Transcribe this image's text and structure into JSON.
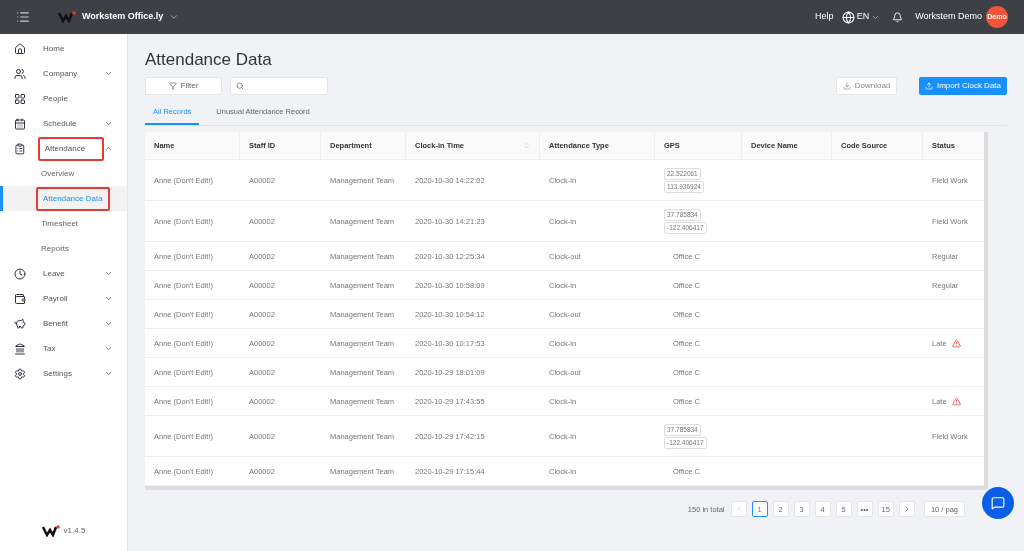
{
  "header": {
    "brand": "Workstem Office.ly",
    "help": "Help",
    "language": "EN",
    "user": "Workstem Demo",
    "avatar": "Demo"
  },
  "sidebar": {
    "items": [
      {
        "label": "Home",
        "expandable": false,
        "annotated": false
      },
      {
        "label": "Company",
        "expandable": true,
        "expanded": false,
        "annotated": false
      },
      {
        "label": "People",
        "expandable": false,
        "annotated": false
      },
      {
        "label": "Schedule",
        "expandable": true,
        "expanded": false,
        "annotated": false
      },
      {
        "label": "Attendance",
        "expandable": true,
        "expanded": true,
        "annotated": true,
        "children": [
          {
            "label": "Overview",
            "selected": false,
            "annotated": false
          },
          {
            "label": "Attendance Data",
            "selected": true,
            "annotated": true
          },
          {
            "label": "Timesheet",
            "selected": false,
            "annotated": false
          },
          {
            "label": "Reports",
            "selected": false,
            "annotated": false
          }
        ]
      },
      {
        "label": "Leave",
        "expandable": true,
        "expanded": false,
        "annotated": false
      },
      {
        "label": "Payroll",
        "expandable": true,
        "expanded": false,
        "annotated": false
      },
      {
        "label": "Benefit",
        "expandable": true,
        "expanded": false,
        "annotated": false
      },
      {
        "label": "Tax",
        "expandable": true,
        "expanded": false,
        "annotated": false
      },
      {
        "label": "Settings",
        "expandable": true,
        "expanded": false,
        "annotated": false
      }
    ],
    "version": "v1.4.5"
  },
  "page": {
    "title": "Attendance Data",
    "filter": "Filter",
    "download": "Download",
    "import": "Import Clock Data"
  },
  "tabs": [
    {
      "label": "All Records",
      "selected": true
    },
    {
      "label": "Unusual Attendance Record",
      "selected": false
    }
  ],
  "table": {
    "columns": [
      {
        "label": "Name",
        "sortable": false
      },
      {
        "label": "Staff ID",
        "sortable": false
      },
      {
        "label": "Department",
        "sortable": false
      },
      {
        "label": "Clock-in Time",
        "sortable": true
      },
      {
        "label": "Attendance Type",
        "sortable": false
      },
      {
        "label": "GPS",
        "sortable": false
      },
      {
        "label": "Device Name",
        "sortable": false
      },
      {
        "label": "Code Source",
        "sortable": false
      },
      {
        "label": "Status",
        "sortable": false
      }
    ],
    "rows": [
      {
        "name": "Anne (Don't Edit!)",
        "staff_id": "A00002",
        "department": "Management Team",
        "time": "2020-10-30 14:22:02",
        "type": "Clock-in",
        "gps": [
          "22.522061",
          "113.936924"
        ],
        "status": "Field Work",
        "warning": false
      },
      {
        "name": "Anne (Don't Edit!)",
        "staff_id": "A00002",
        "department": "Management Team",
        "time": "2020-10-30 14:21:23",
        "type": "Clock-in",
        "gps": [
          "37.785834",
          "-122.406417"
        ],
        "status": "Field Work",
        "warning": false
      },
      {
        "name": "Anne (Don't Edit!)",
        "staff_id": "A00002",
        "department": "Management Team",
        "time": "2020-10-30 12:25:34",
        "type": "Clock-out",
        "location": "Office C",
        "status": "Regular",
        "warning": false
      },
      {
        "name": "Anne (Don't Edit!)",
        "staff_id": "A00002",
        "department": "Management Team",
        "time": "2020-10-30 10:58:09",
        "type": "Clock-in",
        "location": "Office C",
        "status": "Regular",
        "warning": false
      },
      {
        "name": "Anne (Don't Edit!)",
        "staff_id": "A00002",
        "department": "Management Team",
        "time": "2020-10-30 10:54:12",
        "type": "Clock-out",
        "location": "Office C",
        "warning": false
      },
      {
        "name": "Anne (Don't Edit!)",
        "staff_id": "A00002",
        "department": "Management Team",
        "time": "2020-10-30 10:17:53",
        "type": "Clock-in",
        "location": "Office C",
        "status": "Late",
        "warning": true
      },
      {
        "name": "Anne (Don't Edit!)",
        "staff_id": "A00002",
        "department": "Management Team",
        "time": "2020-10-29 18:01:09",
        "type": "Clock-out",
        "location": "Office C",
        "warning": false
      },
      {
        "name": "Anne (Don't Edit!)",
        "staff_id": "A00002",
        "department": "Management Team",
        "time": "2020-10-29 17:43:55",
        "type": "Clock-in",
        "location": "Office C",
        "status": "Late",
        "warning": true
      },
      {
        "name": "Anne (Don't Edit!)",
        "staff_id": "A00002",
        "department": "Management Team",
        "time": "2020-10-29 17:42:15",
        "type": "Clock-in",
        "gps": [
          "37.785834",
          "-122.406417"
        ],
        "status": "Field Work",
        "warning": false
      },
      {
        "name": "Anne (Don't Edit!)",
        "staff_id": "A00002",
        "department": "Management Team",
        "time": "2020-10-29 17:15:44",
        "type": "Clock-in",
        "location": "Office C",
        "warning": false
      }
    ]
  },
  "pagination": {
    "total": "150 in total",
    "pages": [
      {
        "label": "1",
        "selected": true
      },
      {
        "label": "2",
        "selected": false
      },
      {
        "label": "3",
        "selected": false
      },
      {
        "label": "4",
        "selected": false
      },
      {
        "label": "5",
        "selected": false
      },
      {
        "label": "•••",
        "selected": false
      },
      {
        "label": "15",
        "selected": false
      }
    ],
    "page_size": "10 / pag"
  }
}
